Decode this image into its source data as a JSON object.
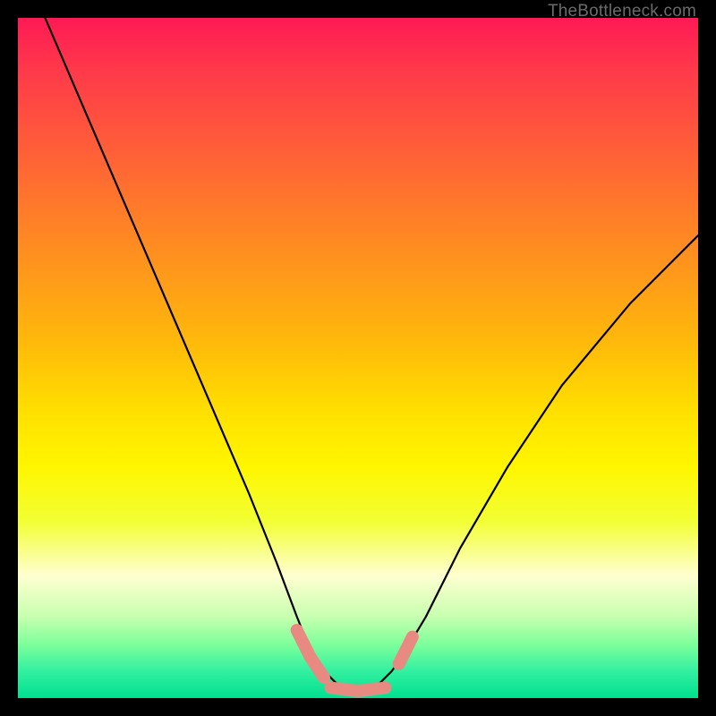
{
  "watermark": "TheBottleneck.com",
  "chart_data": {
    "type": "line",
    "title": "",
    "xlabel": "",
    "ylabel": "",
    "xlim": [
      0,
      100
    ],
    "ylim": [
      0,
      100
    ],
    "series": [
      {
        "name": "bottleneck-curve",
        "x": [
          4,
          10,
          16,
          22,
          28,
          34,
          38,
          41,
          43,
          45,
          47,
          50,
          53,
          55,
          57,
          60,
          65,
          72,
          80,
          90,
          100
        ],
        "y": [
          100,
          86,
          72,
          58,
          44,
          30,
          20,
          12,
          7,
          4,
          2,
          1,
          2,
          4,
          7,
          12,
          22,
          34,
          46,
          58,
          68
        ]
      }
    ],
    "marker_segments": [
      {
        "name": "left-sweet-spot",
        "x": [
          41,
          43,
          45
        ],
        "y": [
          10,
          6,
          3
        ]
      },
      {
        "name": "bottom-sweet-spot",
        "x": [
          46,
          50,
          54
        ],
        "y": [
          1.5,
          1,
          1.5
        ]
      },
      {
        "name": "right-sweet-spot",
        "x": [
          56,
          58
        ],
        "y": [
          5,
          9
        ]
      }
    ],
    "colors": {
      "curve": "#000000",
      "marker": "#e98a82",
      "gradient_top": "#ff1a55",
      "gradient_bottom": "#00e090"
    }
  }
}
